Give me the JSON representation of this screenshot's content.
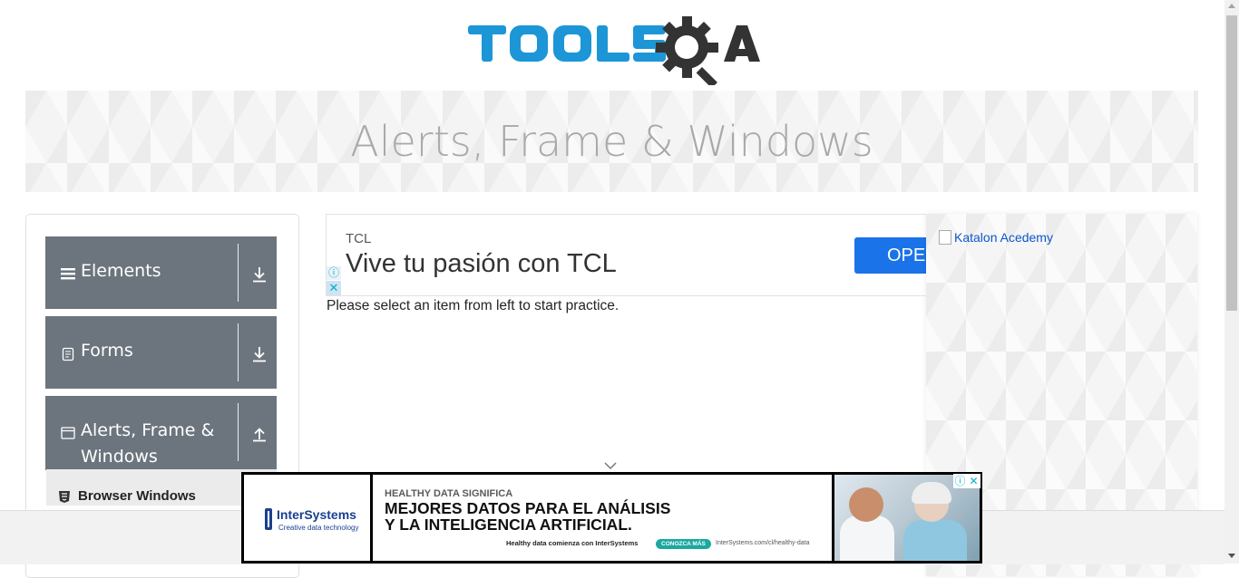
{
  "header": {
    "logo_text": "TOOLSQA"
  },
  "banner": {
    "title": "Alerts, Frame & Windows"
  },
  "sidebar": {
    "groups": [
      {
        "label": "Elements",
        "icon": "hamburger-icon",
        "arrow": "download-arrow-icon"
      },
      {
        "label": "Forms",
        "icon": "document-icon",
        "arrow": "download-arrow-icon"
      },
      {
        "label_line1": "Alerts, Frame &",
        "label_line2": "Windows",
        "icon": "window-icon",
        "arrow": "upload-arrow-icon"
      }
    ],
    "sub_items": [
      {
        "label": "Browser Windows",
        "icon": "html5-icon"
      }
    ]
  },
  "top_ad": {
    "brand": "TCL",
    "headline": "Vive tu pasión con TCL",
    "button": "OPEN",
    "info": "ⓘ",
    "close": "✕"
  },
  "main": {
    "message": "Please select an item from left to start practice."
  },
  "right_ad": {
    "image_alt": "Katalon Acedemy"
  },
  "bottom_ad": {
    "brand": "InterSystems",
    "brand_tag": "Creative data technology",
    "kicker": "HEALTHY DATA SIGNIFICA",
    "headline_line1": "MEJORES DATOS PARA EL ANÁLISIS",
    "headline_line2": "Y LA INTELIGENCIA ARTIFICIAL.",
    "tagline": "Healthy data comienza con InterSystems",
    "cta": "CONOZCA MÁS",
    "url": "InterSystems.com/cl/healthy-data",
    "info": "ⓘ",
    "close": "✕"
  },
  "colors": {
    "logo_blue": "#1c96d6",
    "logo_dark": "#333333",
    "sidebar_group": "#6c757d",
    "ad_button": "#1a73e8"
  }
}
